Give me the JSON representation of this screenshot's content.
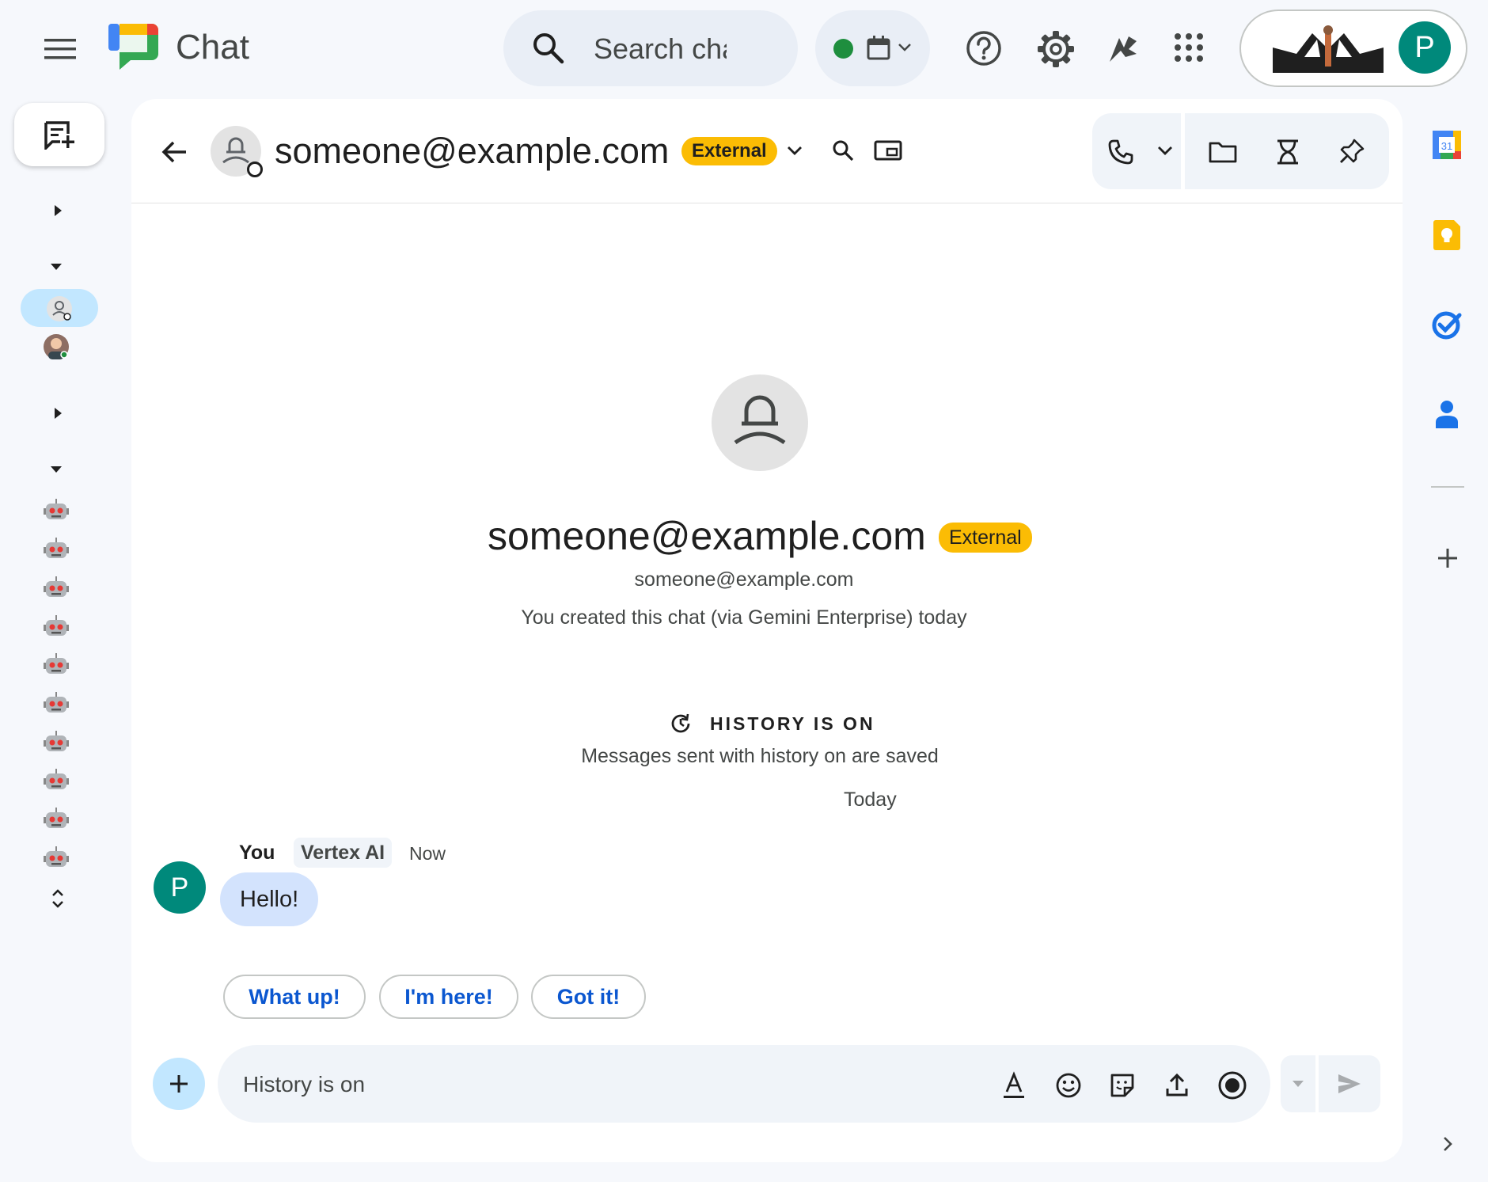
{
  "app": {
    "title": "Chat"
  },
  "search": {
    "placeholder": "Search chats"
  },
  "header": {
    "name": "someone@example.com",
    "badge": "External"
  },
  "intro": {
    "name": "someone@example.com",
    "badge": "External",
    "email": "someone@example.com",
    "created_text": "You created this chat (via Gemini Enterprise) today"
  },
  "history": {
    "title": "HISTORY IS ON",
    "subtitle": "Messages sent with history on are saved"
  },
  "day_divider": "Today",
  "message": {
    "avatar_letter": "P",
    "sender": "You",
    "via": "Vertex AI",
    "time": "Now",
    "text": "Hello!"
  },
  "suggestions": [
    "What up!",
    "I'm here!",
    "Got it!"
  ],
  "composer": {
    "placeholder": "History is on"
  },
  "account": {
    "avatar_letter": "P"
  },
  "colors": {
    "background": "#f6f8fc",
    "accent": "#0b57d0",
    "badge": "#fbbc04",
    "avatar": "#00897b",
    "online": "#1e8e3e",
    "bubble": "#d3e3fd"
  },
  "icons": {
    "top": [
      "menu-icon",
      "chat-logo-icon",
      "search-icon",
      "status-dot-icon",
      "calendar-status-icon",
      "help-icon",
      "settings-icon",
      "gemini-icon",
      "apps-grid-icon"
    ],
    "header": [
      "back-arrow-icon",
      "person-avatar-icon",
      "chevron-down-icon",
      "search-icon",
      "picture-in-picture-icon",
      "phone-icon",
      "folder-icon",
      "tasks-icon",
      "pin-icon"
    ],
    "composer": [
      "add-icon",
      "format-text-icon",
      "emoji-icon",
      "sticker-icon",
      "upload-icon",
      "record-icon",
      "send-icon"
    ],
    "side": [
      "calendar-icon",
      "keep-icon",
      "tasks-icon",
      "contacts-icon",
      "add-icon",
      "chevron-right-icon"
    ]
  }
}
